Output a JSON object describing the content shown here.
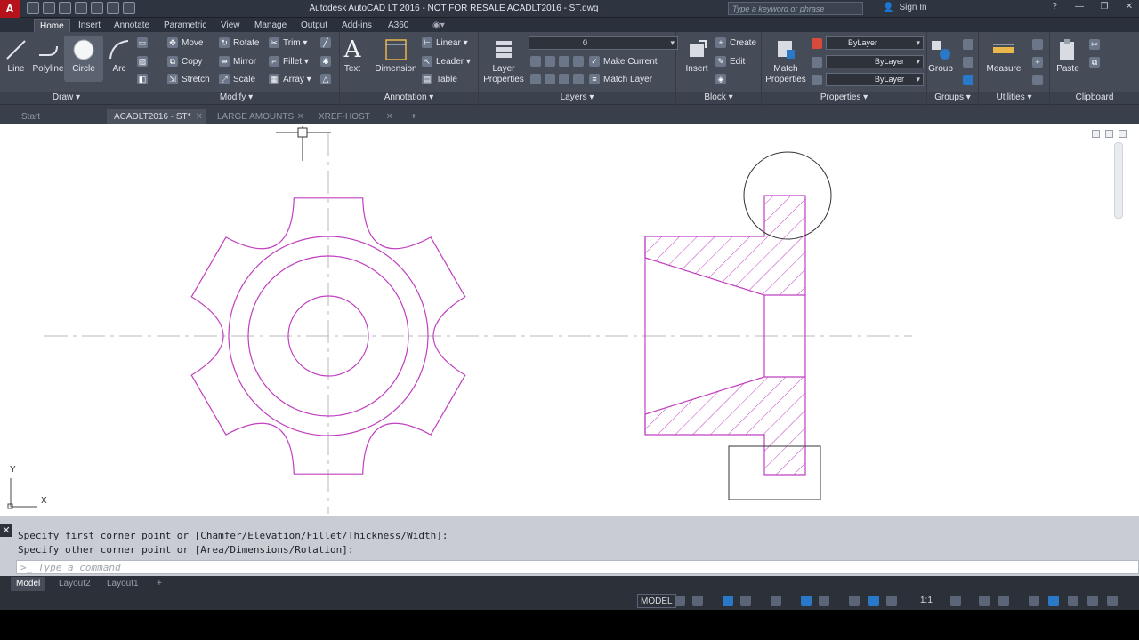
{
  "app": {
    "title": "Autodesk AutoCAD LT 2016 - NOT FOR RESALE     ACADLT2016 - ST.dwg",
    "logo": "A",
    "search_placeholder": "Type a keyword or phrase",
    "sign_in": "Sign In"
  },
  "ribbon_tabs": [
    "Home",
    "Insert",
    "Annotate",
    "Parametric",
    "View",
    "Manage",
    "Output",
    "Add-ins",
    "A360"
  ],
  "panels": {
    "draw": {
      "title": "Draw ▾",
      "line": "Line",
      "polyline": "Polyline",
      "circle": "Circle",
      "arc": "Arc"
    },
    "modify": {
      "title": "Modify ▾",
      "move": "Move",
      "rotate": "Rotate",
      "trim": "Trim ▾",
      "copy": "Copy",
      "mirror": "Mirror",
      "fillet": "Fillet ▾",
      "stretch": "Stretch",
      "scale": "Scale",
      "array": "Array ▾"
    },
    "annotation": {
      "title": "Annotation ▾",
      "text": "Text",
      "dimension": "Dimension",
      "linear": "Linear ▾",
      "leader": "Leader ▾",
      "table": "Table"
    },
    "layers": {
      "title": "Layers ▾",
      "layer_props": "Layer Properties",
      "layer_combo": "0",
      "make_current": "Make Current",
      "match_layer": "Match Layer"
    },
    "block": {
      "title": "Block ▾",
      "insert": "Insert",
      "create": "Create",
      "edit": "Edit"
    },
    "properties": {
      "title": "Properties ▾",
      "match": "Match Properties",
      "color": "ByLayer",
      "linetype": "ByLayer",
      "lineweight": "ByLayer"
    },
    "groups": {
      "title": "Groups ▾",
      "group": "Group"
    },
    "utilities": {
      "title": "Utilities ▾",
      "measure": "Measure"
    },
    "clipboard": {
      "title": "Clipboard",
      "paste": "Paste"
    }
  },
  "file_tabs": [
    {
      "label": "Start"
    },
    {
      "label": "ACADLT2016 - ST*"
    },
    {
      "label": "LARGE AMOUNTS"
    },
    {
      "label": "XREF-HOST"
    }
  ],
  "file_tab_add": "+",
  "canvas": {
    "ucs_x": "X",
    "ucs_y": "Y"
  },
  "command": {
    "line1": "Specify first corner point or [Chamfer/Elevation/Fillet/Thickness/Width]:",
    "line2": "Specify other corner point or [Area/Dimensions/Rotation]:",
    "placeholder": "Type a command",
    "close": "✕"
  },
  "layout_tabs": [
    "Model",
    "Layout2",
    "Layout1",
    "+"
  ],
  "status": {
    "model": "MODEL",
    "scale": "1:1"
  },
  "colors": {
    "drawing_magenta": "#c040c0",
    "ribbon_bg": "#454b57",
    "accent_blue": "#2a78c8"
  }
}
